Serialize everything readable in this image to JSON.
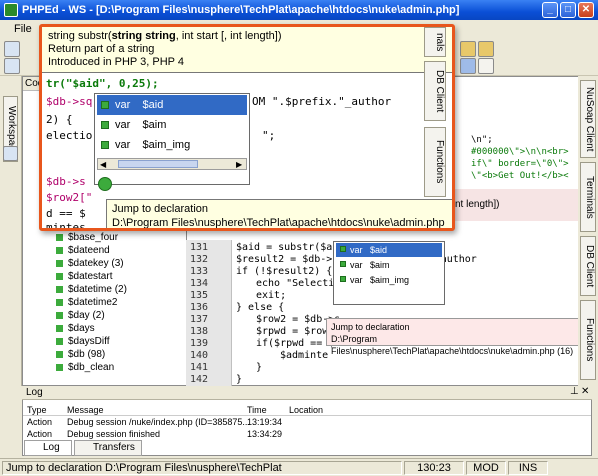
{
  "window": {
    "title": "PHPEd - WS - [D:\\Program Files\\nusphere\\TechPlat\\apache\\htdocs\\nuke\\admin.php]"
  },
  "menu": {
    "file": "File"
  },
  "left_panel": {
    "workspace_tab": "Workspace",
    "code_tab": "Code",
    "vars": [
      {
        "label": "$base_four"
      },
      {
        "label": "$dateend"
      },
      {
        "label": "$datekey (3)"
      },
      {
        "label": "$datestart"
      },
      {
        "label": "$datetime (2)"
      },
      {
        "label": "$datetime2"
      },
      {
        "label": "$day (2)"
      },
      {
        "label": "$days"
      },
      {
        "label": "$daysDiff"
      },
      {
        "label": "$db (98)"
      },
      {
        "label": "$db_clean"
      }
    ]
  },
  "right_tabs": {
    "nusoap": "NuSoap Client",
    "terminals": "Terminals",
    "dbclient": "DB Client",
    "functions": "Functions"
  },
  "zoom_tabs": {
    "terminals": "nals",
    "dbclient": "DB Client",
    "functions": "Functions"
  },
  "editor": {
    "line_numbers": [
      "131",
      "132",
      "133",
      "134",
      "135",
      "136",
      "137",
      "138",
      "139",
      "140",
      "141",
      "142"
    ],
    "lines": [
      "$aid = substr($aid, 0,25);",
      "$result2 = $db->sq       OM \".$prefix.\"_author",
      "if (!$result2) {",
      "echo \"Selectio            \";",
      "exit;",
      "} else {",
      "$row2 = $db->s",
      "$rpwd = $row2[\"",
      "if($rpwd == $",
      "$adminte",
      "}",
      "}"
    ],
    "top_lines": [
      "\\n\";",
      "#000000\\\">\\n\\n<br>",
      "if\\\" border=\\\"0\\\">",
      "\\\"<b>Get Out!</b><"
    ],
    "autocomplete": [
      {
        "type": "var",
        "name": "$aid"
      },
      {
        "type": "var",
        "name": "$aim"
      },
      {
        "type": "var",
        "name": "$aim_img"
      }
    ],
    "jump_label": "Jump to declaration",
    "jump_path": "D:\\Program Files\\nusphere\\TechPlat\\apache\\htdocs\\nuke\\admin.php (16)",
    "hint_tail": "nt length])"
  },
  "zoom": {
    "tip_sig_pre": "string substr(",
    "tip_sig_b1": "string string",
    "tip_sig_mid": ", int start [, int length])",
    "tip_line2": "Return part of a string",
    "tip_line3": "Introduced in PHP 3, PHP 4",
    "code": [
      "tr(\"$aid\", 0,25);",
      "$db->sq",
      "2) {",
      "electio",
      "$db->s",
      "$row2[\"",
      "d == $",
      "mintes"
    ],
    "code_tails": [
      "OM \".$prefix.\"_author",
      "\";"
    ]
  },
  "log": {
    "title": "Log",
    "columns": [
      "Type",
      "Message",
      "Time",
      "Location"
    ],
    "rows": [
      {
        "type": "Action",
        "message": "Debug session /nuke/index.php (ID=385875...",
        "time": "13:19:34",
        "location": ""
      },
      {
        "type": "Action",
        "message": "Debug session finished",
        "time": "13:34:29",
        "location": ""
      }
    ]
  },
  "bottom_tabs": {
    "log": "Log",
    "transfers": "Transfers"
  },
  "status": {
    "message": "Jump to declaration D:\\Program Files\\nusphere\\TechPlat",
    "position": "130:23",
    "mode": "MOD",
    "ins": "INS"
  }
}
